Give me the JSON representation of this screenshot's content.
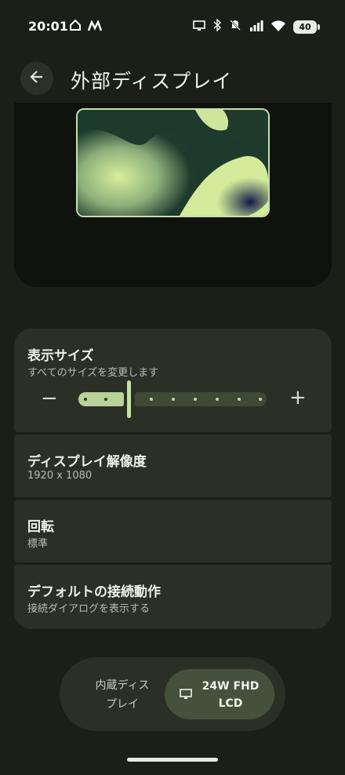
{
  "status_bar": {
    "time": "20:01",
    "left_icons": [
      "home-icon",
      "m-icon"
    ],
    "right_icons": [
      "monitor-icon",
      "bluetooth-icon",
      "mute-icon",
      "signal-icon",
      "wifi-icon"
    ],
    "battery": "40"
  },
  "header": {
    "back_icon": "arrow-back-icon",
    "title": "外部ディスプレイ"
  },
  "display_size": {
    "title": "表示サイズ",
    "subtitle": "すべてのサイズを変更します",
    "minus": "−",
    "plus": "+",
    "level": 2,
    "max_level": 9
  },
  "resolution": {
    "title": "ディスプレイ解像度",
    "value": "1920 x 1080"
  },
  "rotation": {
    "title": "回転",
    "value": "標準"
  },
  "default_action": {
    "title": "デフォルトの接続動作",
    "value": "接続ダイアログを表示する"
  },
  "display_switch": {
    "internal": "内蔵ディス\nプレイ",
    "external": "24W FHD\nLCD",
    "selected": "external"
  },
  "colors": {
    "background": "#1b1f17",
    "card": "#2b3027",
    "accent": "#b9d29a"
  }
}
